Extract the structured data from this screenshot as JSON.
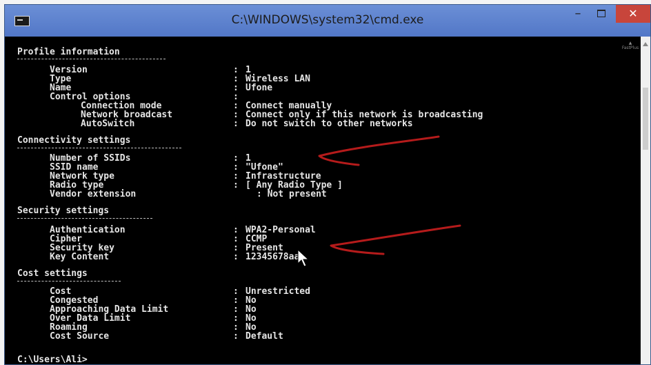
{
  "window": {
    "title": "C:\\WINDOWS\\system32\\cmd.exe",
    "controls": {
      "minimize": "–",
      "close": "✕"
    }
  },
  "console": {
    "profile": {
      "heading": "Profile information",
      "rows": [
        {
          "label": "Version",
          "value": "1"
        },
        {
          "label": "Type",
          "value": "Wireless LAN"
        },
        {
          "label": "Name",
          "value": "Ufone"
        },
        {
          "label": "Control options",
          "value": ""
        }
      ],
      "control_rows": [
        {
          "label": "Connection mode",
          "value": "Connect manually"
        },
        {
          "label": "Network broadcast",
          "value": "Connect only if this network is broadcasting"
        },
        {
          "label": "AutoSwitch",
          "value": "Do not switch to other networks"
        }
      ]
    },
    "connectivity": {
      "heading": "Connectivity settings",
      "rows": [
        {
          "label": "Number of SSIDs",
          "value": "1"
        },
        {
          "label": "SSID name",
          "value": "\"Ufone\""
        },
        {
          "label": "Network type",
          "value": "Infrastructure"
        },
        {
          "label": "Radio type",
          "value": "[ Any Radio Type ]"
        },
        {
          "label": "Vendor extension",
          "value": ": Not present"
        }
      ]
    },
    "security": {
      "heading": "Security settings",
      "rows": [
        {
          "label": "Authentication",
          "value": "WPA2-Personal"
        },
        {
          "label": "Cipher",
          "value": "CCMP"
        },
        {
          "label": "Security key",
          "value": "Present"
        },
        {
          "label": "Key Content",
          "value": "12345678aa"
        }
      ]
    },
    "cost": {
      "heading": "Cost settings",
      "rows": [
        {
          "label": "Cost",
          "value": "Unrestricted"
        },
        {
          "label": "Congested",
          "value": "No"
        },
        {
          "label": "Approaching Data Limit",
          "value": "No"
        },
        {
          "label": "Over Data Limit",
          "value": "No"
        },
        {
          "label": "Roaming",
          "value": "No"
        },
        {
          "label": "Cost Source",
          "value": "Default"
        }
      ]
    },
    "prompt": "C:\\Users\\Ali>"
  },
  "annotations": {
    "stroke_color": "#b51b1b"
  },
  "watermark_text": "FastPlus"
}
